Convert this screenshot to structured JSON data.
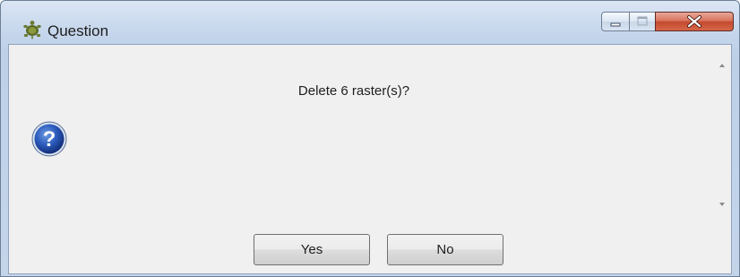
{
  "window": {
    "title": "Question",
    "app_icon": "turtle-icon",
    "controls": {
      "minimize": "minimize-icon",
      "maximize": "maximize-icon",
      "close": "close-icon"
    }
  },
  "dialog": {
    "icon": "question-icon",
    "message": "Delete 6 raster(s)?",
    "buttons": {
      "yes_label": "Yes",
      "no_label": "No"
    }
  },
  "colors": {
    "frame": "#c8d8ed",
    "content_bg": "#f0f0f0",
    "close_button": "#c44a2f",
    "question_icon": "#1f4fa8"
  }
}
